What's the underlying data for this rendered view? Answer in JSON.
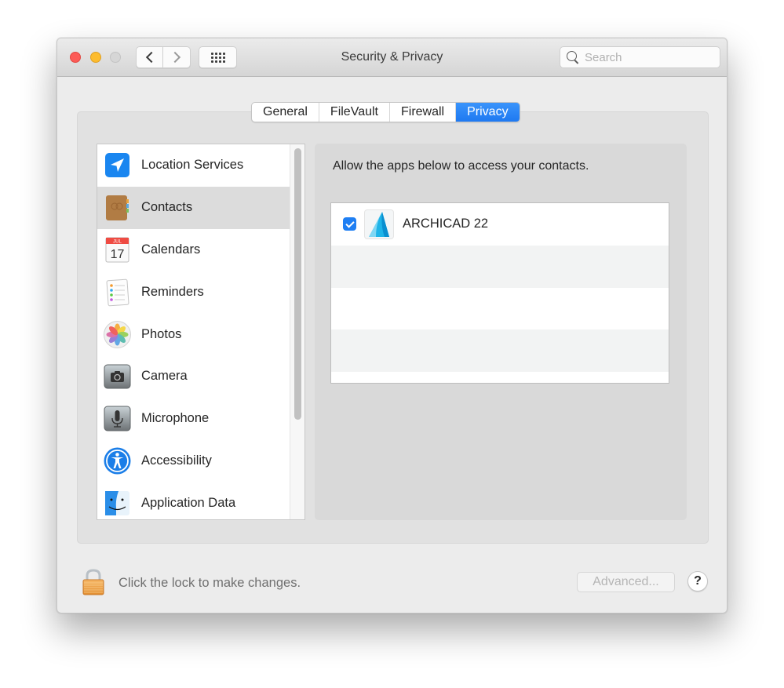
{
  "window": {
    "title": "Security & Privacy"
  },
  "toolbar": {
    "back_icon": "chevron-left-icon",
    "forward_icon": "chevron-right-icon",
    "grid_icon": "show-all-grid-icon",
    "search_placeholder": "Search",
    "search_value": ""
  },
  "tabs": [
    {
      "label": "General",
      "active": false
    },
    {
      "label": "FileVault",
      "active": false
    },
    {
      "label": "Firewall",
      "active": false
    },
    {
      "label": "Privacy",
      "active": true
    }
  ],
  "sidebar": {
    "items": [
      {
        "label": "Location Services",
        "icon": "location-arrow-icon",
        "selected": false
      },
      {
        "label": "Contacts",
        "icon": "contacts-book-icon",
        "selected": true
      },
      {
        "label": "Calendars",
        "icon": "calendar-icon",
        "selected": false,
        "icon_text": {
          "month": "JUL",
          "day": "17"
        }
      },
      {
        "label": "Reminders",
        "icon": "reminders-list-icon",
        "selected": false
      },
      {
        "label": "Photos",
        "icon": "photos-flower-icon",
        "selected": false
      },
      {
        "label": "Camera",
        "icon": "camera-icon",
        "selected": false
      },
      {
        "label": "Microphone",
        "icon": "microphone-icon",
        "selected": false
      },
      {
        "label": "Accessibility",
        "icon": "accessibility-icon",
        "selected": false
      },
      {
        "label": "Application Data",
        "icon": "finder-icon",
        "selected": false
      }
    ]
  },
  "detail": {
    "description": "Allow the apps below to access your contacts.",
    "apps": [
      {
        "name": "ARCHICAD 22",
        "checked": true,
        "icon": "archicad-icon"
      }
    ]
  },
  "footer": {
    "lock_text": "Click the lock to make changes.",
    "lock_icon": "padlock-icon",
    "advanced_label": "Advanced...",
    "help_label": "?"
  },
  "colors": {
    "accent": "#1e79f1",
    "traffic_close": "#fc5b57",
    "traffic_minimize": "#fdbc2e",
    "traffic_zoom_disabled": "#d6d6d6"
  }
}
